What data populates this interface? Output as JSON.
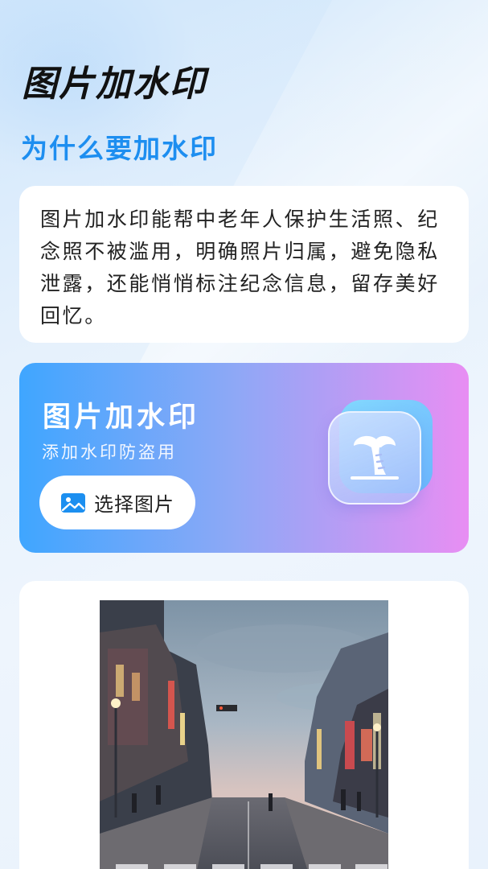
{
  "header": {
    "title": "图片加水印"
  },
  "why": {
    "title": "为什么要加水印",
    "description": "图片加水印能帮中老年人保护生活照、纪念照不被滥用，明确照片归属，避免隐私泄露，还能悄悄标注纪念信息，留存美好回忆。"
  },
  "hero": {
    "title": "图片加水印",
    "subtitle": "添加水印防盗用",
    "button_label": "选择图片",
    "button_icon": "image-icon",
    "art_icon": "palm-tree-icon"
  },
  "preview": {
    "image": "city-street-photo"
  },
  "colors": {
    "accent": "#1d8ef0",
    "hero_gradient_start": "#3fa6ff",
    "hero_gradient_end": "#e88ef3"
  }
}
